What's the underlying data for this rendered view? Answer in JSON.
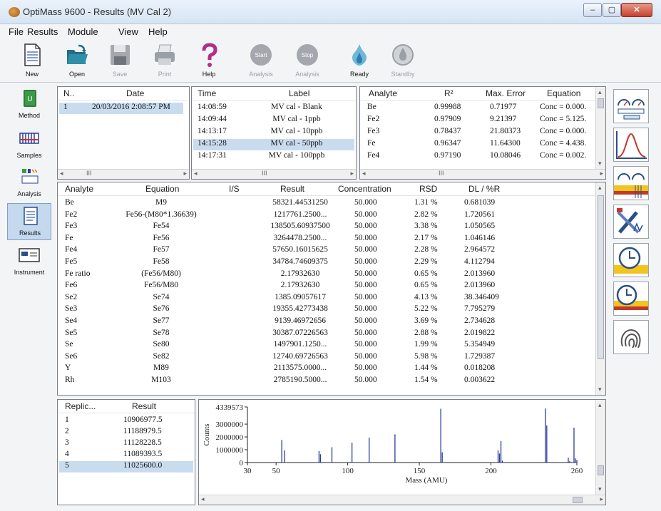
{
  "window": {
    "title": "OptiMass 9600 - Results (MV Cal 2)",
    "min_glyph": "–",
    "max_glyph": "▢",
    "close_glyph": "✕"
  },
  "menu": [
    "File",
    "Results",
    "Module",
    "View",
    "Help"
  ],
  "toolbar": {
    "new": "New",
    "open": "Open",
    "save": "Save",
    "print": "Print",
    "help": "Help",
    "start_analysis": "Analysis",
    "start_word": "Start",
    "stop_analysis": "Analysis",
    "stop_word": "Stop",
    "ready": "Ready",
    "standby": "Standby"
  },
  "sidebar": {
    "method": "Method",
    "samples": "Samples",
    "analysis": "Analysis",
    "results": "Results",
    "instrument": "Instrument"
  },
  "runs": {
    "headers": [
      "N..",
      "Date"
    ],
    "rows": [
      {
        "n": "1",
        "date": "20/03/2016 2:08:57 PM"
      }
    ],
    "scroll_mark": "III"
  },
  "samples": {
    "headers": [
      "Time",
      "Label"
    ],
    "rows": [
      {
        "time": "14:08:59",
        "label": "MV cal - Blank"
      },
      {
        "time": "14:09:44",
        "label": "MV cal - 1ppb"
      },
      {
        "time": "14:13:17",
        "label": "MV cal - 10ppb"
      },
      {
        "time": "14:15:28",
        "label": "MV cal - 50ppb"
      },
      {
        "time": "14:17:31",
        "label": "MV cal - 100ppb"
      }
    ],
    "selected_index": 3,
    "scroll_mark": "III"
  },
  "calibration": {
    "headers": [
      "Analyte",
      "R²",
      "Max. Error",
      "Equation"
    ],
    "rows": [
      {
        "analyte": "Be",
        "r2": "0.99988",
        "max_error": "0.71977",
        "equation": "Conc = 0.000."
      },
      {
        "analyte": "Fe2",
        "r2": "0.97909",
        "max_error": "9.21397",
        "equation": "Conc = 5.125."
      },
      {
        "analyte": "Fe3",
        "r2": "0.78437",
        "max_error": "21.80373",
        "equation": "Conc = 0.000."
      },
      {
        "analyte": "Fe",
        "r2": "0.96347",
        "max_error": "11.64300",
        "equation": "Conc = 4.438."
      },
      {
        "analyte": "Fe4",
        "r2": "0.97190",
        "max_error": "10.08046",
        "equation": "Conc = 0.002."
      }
    ],
    "scroll_mark": "III"
  },
  "results": {
    "headers": [
      "Analyte",
      "Equation",
      "I/S",
      "Result",
      "Concentration",
      "RSD",
      "DL / %R"
    ],
    "rows": [
      {
        "analyte": "Be",
        "equation": "M9",
        "is": "",
        "result": "58321.44531250",
        "conc": "50.000",
        "rsd": "1.31 %",
        "dl": "0.681039"
      },
      {
        "analyte": "Fe2",
        "equation": "Fe56-(M80*1.36639)",
        "is": "",
        "result": "1217761.2500...",
        "conc": "50.000",
        "rsd": "2.82 %",
        "dl": "1.720561"
      },
      {
        "analyte": "Fe3",
        "equation": "Fe54",
        "is": "",
        "result": "138505.60937500",
        "conc": "50.000",
        "rsd": "3.38 %",
        "dl": "1.050565"
      },
      {
        "analyte": "Fe",
        "equation": "Fe56",
        "is": "",
        "result": "3264478.2500...",
        "conc": "50.000",
        "rsd": "2.17 %",
        "dl": "1.046146"
      },
      {
        "analyte": "Fe4",
        "equation": "Fe57",
        "is": "",
        "result": "57650.16015625",
        "conc": "50.000",
        "rsd": "2.28 %",
        "dl": "2.964572"
      },
      {
        "analyte": "Fe5",
        "equation": "Fe58",
        "is": "",
        "result": "34784.74609375",
        "conc": "50.000",
        "rsd": "2.29 %",
        "dl": "4.112794"
      },
      {
        "analyte": "Fe ratio",
        "equation": "(Fe56/M80)",
        "is": "",
        "result": "2.17932630",
        "conc": "50.000",
        "rsd": "0.65 %",
        "dl": "2.013960"
      },
      {
        "analyte": "Fe6",
        "equation": "Fe56/M80",
        "is": "",
        "result": "2.17932630",
        "conc": "50.000",
        "rsd": "0.65 %",
        "dl": "2.013960"
      },
      {
        "analyte": "Se2",
        "equation": "Se74",
        "is": "",
        "result": "1385.09057617",
        "conc": "50.000",
        "rsd": "4.13 %",
        "dl": "38.346409"
      },
      {
        "analyte": "Se3",
        "equation": "Se76",
        "is": "",
        "result": "19355.42773438",
        "conc": "50.000",
        "rsd": "5.22 %",
        "dl": "7.795279"
      },
      {
        "analyte": "Se4",
        "equation": "Se77",
        "is": "",
        "result": "9139.46972656",
        "conc": "50.000",
        "rsd": "3.69 %",
        "dl": "2.734628"
      },
      {
        "analyte": "Se5",
        "equation": "Se78",
        "is": "",
        "result": "30387.07226563",
        "conc": "50.000",
        "rsd": "2.88 %",
        "dl": "2.019822"
      },
      {
        "analyte": "Se",
        "equation": "Se80",
        "is": "",
        "result": "1497901.1250...",
        "conc": "50.000",
        "rsd": "1.99 %",
        "dl": "5.354949"
      },
      {
        "analyte": "Se6",
        "equation": "Se82",
        "is": "",
        "result": "12740.69726563",
        "conc": "50.000",
        "rsd": "5.98 %",
        "dl": "1.729387"
      },
      {
        "analyte": "Y",
        "equation": "M89",
        "is": "",
        "result": "2113575.0000...",
        "conc": "50.000",
        "rsd": "1.44 %",
        "dl": "0.018208"
      },
      {
        "analyte": "Rh",
        "equation": "M103",
        "is": "",
        "result": "2785190.5000...",
        "conc": "50.000",
        "rsd": "1.54 %",
        "dl": "0.003622"
      }
    ]
  },
  "replicates": {
    "headers": [
      "Replic...",
      "Result"
    ],
    "rows": [
      {
        "n": "1",
        "result": "10906977.5"
      },
      {
        "n": "2",
        "result": "11188979.5"
      },
      {
        "n": "3",
        "result": "11128228.5"
      },
      {
        "n": "4",
        "result": "11089393.5"
      },
      {
        "n": "5",
        "result": "11025600.0"
      }
    ],
    "selected_index": 4
  },
  "chart_data": {
    "type": "bar",
    "title": "",
    "xlabel": "Mass (AMU)",
    "ylabel": "Counts",
    "xlim": [
      30,
      260
    ],
    "ylim": [
      0,
      4339573
    ],
    "x_ticks": [
      30,
      50,
      100,
      150,
      200,
      260
    ],
    "y_ticks": [
      0,
      1000000,
      2000000,
      3000000,
      4339573
    ],
    "y_tick_labels": [
      "0",
      "1000000",
      "2000000",
      "3000000",
      "4339573"
    ],
    "x": [
      54,
      56,
      80,
      81,
      89,
      103,
      115,
      133,
      165,
      166,
      205,
      206,
      207,
      208,
      238,
      239,
      254,
      255,
      258,
      259,
      260
    ],
    "values": [
      1760000,
      950000,
      900000,
      650000,
      1200000,
      1550000,
      1950000,
      2200000,
      4200000,
      800000,
      950000,
      700000,
      1680000,
      150000,
      4220000,
      2900000,
      380000,
      120000,
      2720000,
      320000,
      200000
    ],
    "series_color": "#2b3c9a"
  }
}
